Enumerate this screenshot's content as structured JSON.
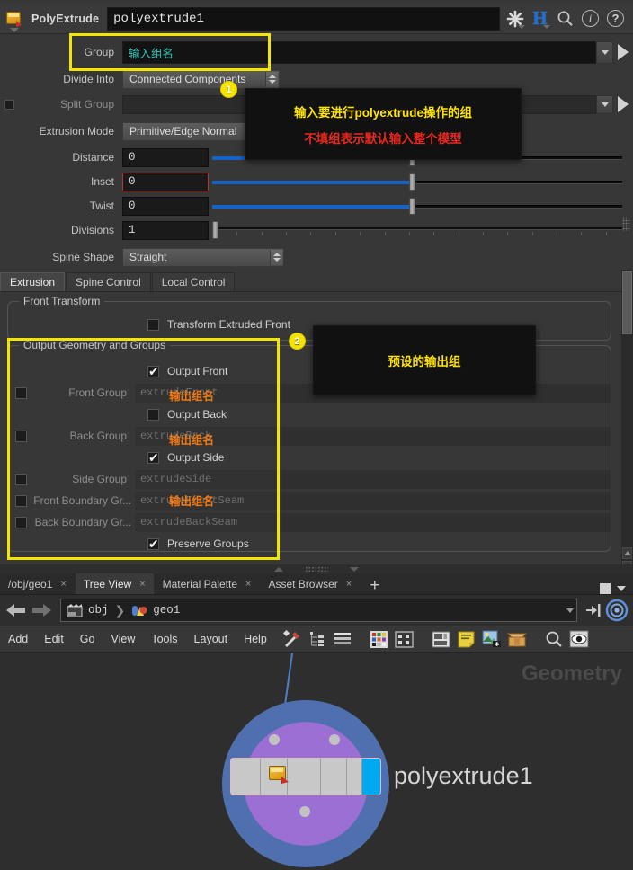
{
  "param_editor": {
    "operator_type": "PolyExtrude",
    "node_name": "polyextrude1",
    "header_icons": [
      {
        "name": "gear-icon",
        "glyph": "gear"
      },
      {
        "name": "houdini-h-icon",
        "glyph": "H"
      },
      {
        "name": "search-icon",
        "glyph": "search"
      },
      {
        "name": "info-icon",
        "glyph": "i"
      },
      {
        "name": "help-icon",
        "glyph": "?"
      }
    ],
    "rows": [
      {
        "label": "Group",
        "value": "输入组名",
        "type": "string-menu",
        "has_checkbox": false
      },
      {
        "label": "Divide Into",
        "value": "Connected Components",
        "type": "menu",
        "has_checkbox": false
      },
      {
        "label": "Split Group",
        "value": "",
        "type": "string-menu",
        "has_checkbox": true,
        "disabled": true
      },
      {
        "label": "Extrusion Mode",
        "value": "Primitive/Edge Normal",
        "type": "menu",
        "has_checkbox": false
      },
      {
        "label": "Distance",
        "value": "0",
        "type": "slider",
        "has_checkbox": false
      },
      {
        "label": "Inset",
        "value": "0",
        "type": "slider",
        "has_checkbox": false,
        "error": true
      },
      {
        "label": "Twist",
        "value": "0",
        "type": "slider",
        "has_checkbox": false
      },
      {
        "label": "Divisions",
        "value": "1",
        "type": "ruler",
        "has_checkbox": false
      },
      {
        "label": "Spine Shape",
        "value": "Straight",
        "type": "menu",
        "has_checkbox": false
      }
    ],
    "tabs": [
      {
        "label": "Extrusion",
        "active": true
      },
      {
        "label": "Spine Control",
        "active": false
      },
      {
        "label": "Local Control",
        "active": false
      }
    ],
    "front_transform": {
      "title": "Front Transform",
      "checkbox": {
        "label": "Transform Extruded Front",
        "checked": false
      }
    },
    "output_section": {
      "title": "Output Geometry and Groups",
      "items": [
        {
          "kind": "toggle",
          "label": "Output Front",
          "checked": true
        },
        {
          "kind": "string",
          "label": "Front Group",
          "value": "extrudeFront",
          "has_checkbox": true
        },
        {
          "kind": "toggle",
          "label": "Output Back",
          "checked": false
        },
        {
          "kind": "string",
          "label": "Back Group",
          "value": "extrudeBack",
          "has_checkbox": true
        },
        {
          "kind": "toggle",
          "label": "Output Side",
          "checked": true
        },
        {
          "kind": "string",
          "label": "Side Group",
          "value": "extrudeSide",
          "has_checkbox": true
        },
        {
          "kind": "string",
          "label": "Front Boundary Gr...",
          "value": "extrudeFrontSeam",
          "has_checkbox": true,
          "label_inline": true
        },
        {
          "kind": "string",
          "label": "Back Boundary Gr...",
          "value": "extrudeBackSeam",
          "has_checkbox": true,
          "label_inline": true
        },
        {
          "kind": "toggle",
          "label": "Preserve Groups",
          "checked": true
        }
      ]
    }
  },
  "annotations": {
    "badge_1": "1",
    "badge_2": "2",
    "tooltip_1_line1": "输入要进行polyextrude操作的组",
    "tooltip_1_line2": "不填组表示默认输入整个模型",
    "tooltip_2_line1": "预设的输出组",
    "orange_front": "输出组名",
    "orange_back": "输出组名",
    "orange_boundary": "输出组名",
    "highlight_color": "#f2e500",
    "tip_yellow": "#ffe400",
    "tip_red": "#e8281e",
    "orange": "#f07a13"
  },
  "network_editor": {
    "tabs": [
      {
        "label": "/obj/geo1",
        "active": false,
        "closable": true
      },
      {
        "label": "Tree View",
        "active": true,
        "closable": true
      },
      {
        "label": "Material Palette",
        "active": false,
        "closable": true
      },
      {
        "label": "Asset Browser",
        "active": false,
        "closable": true
      }
    ],
    "add_tab_label": "+",
    "breadcrumb": [
      {
        "label": "obj",
        "icon": "obj-context-icon"
      },
      {
        "label": "geo1",
        "icon": "geometry-object-icon"
      }
    ],
    "menus": [
      "Add",
      "Edit",
      "Go",
      "View",
      "Tools",
      "Layout",
      "Help"
    ],
    "tool_icons": [
      "tools-icon",
      "hierarchy-icon",
      "list-layers-icon",
      "color-palette-icon",
      "layout-grid-icon",
      "panel-layout-icon",
      "sticky-note-icon",
      "add-image-icon",
      "package-box-icon",
      "search-icon",
      "display-eye-icon"
    ],
    "canvas": {
      "context_watermark": "Geometry",
      "node": {
        "name": "polyextrude1",
        "icon": "polyextrude-node-icon",
        "halo_outer_color": "#4f6fae",
        "halo_inner_color": "#9b6fd4",
        "flag_color": "#00a8f0"
      }
    }
  }
}
